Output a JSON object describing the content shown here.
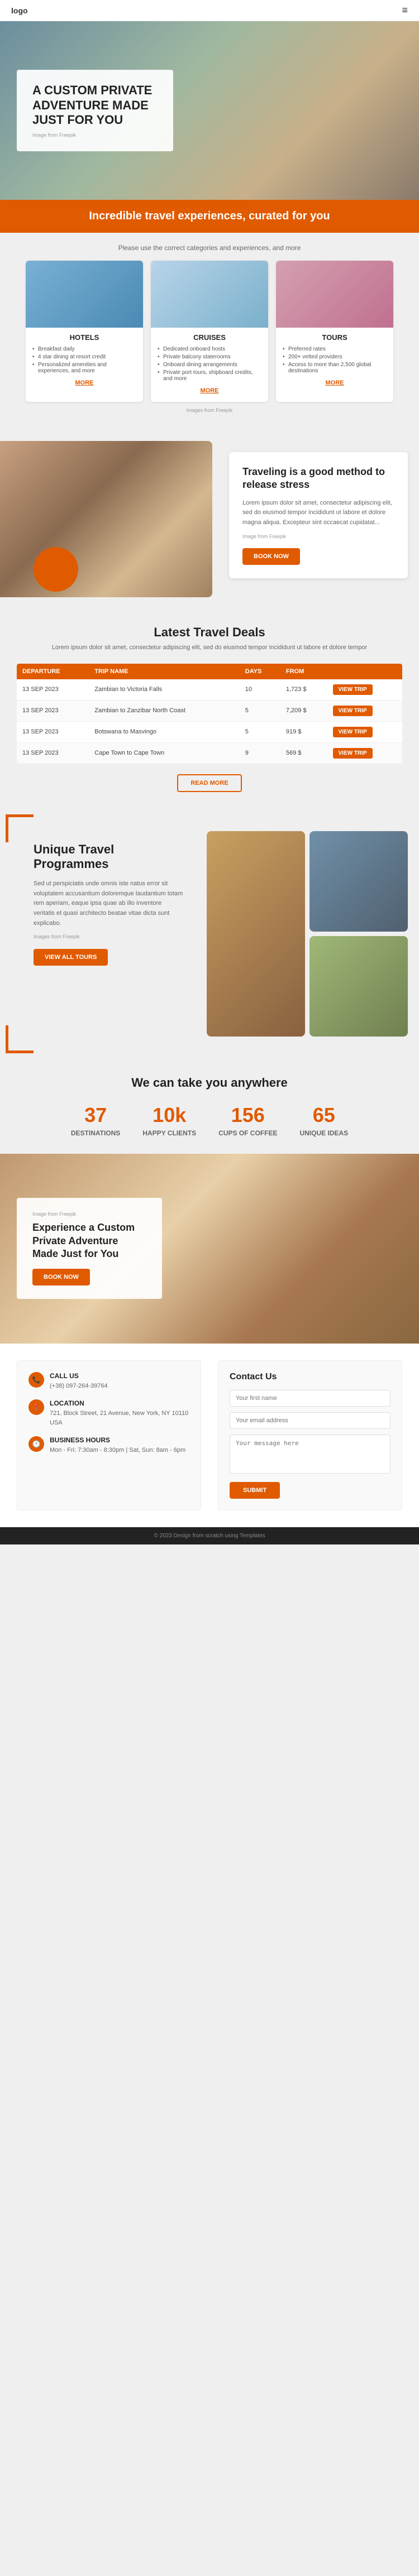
{
  "header": {
    "logo": "logo",
    "menu_icon": "≡"
  },
  "hero": {
    "title": "A CUSTOM PRIVATE ADVENTURE MADE JUST FOR YOU",
    "image_credit": "Image from Freepik"
  },
  "tagline": {
    "text": "Incredible travel experiences, curated for you"
  },
  "cards_section": {
    "subtitle": "Please use the correct categories and experiences, and more",
    "hotels": {
      "title": "HOTELS",
      "features": [
        "Breakfast daily",
        "4 star dining at resort credit",
        "Personalized amenities and experiences, and more"
      ],
      "more": "MORE"
    },
    "cruises": {
      "title": "CRUISES",
      "features": [
        "Dedicated onboard hosts",
        "Private balcony staterooms",
        "Onboard dining arrangements",
        "Private port tours, shipboard credits, and more"
      ],
      "more": "MORE"
    },
    "tours": {
      "title": "TOURS",
      "features": [
        "Preferred rates",
        "200+ vetted providers",
        "Access to more than 2,500 global destinations"
      ],
      "more": "MORE"
    },
    "image_credit": "Images from Freepik"
  },
  "stress": {
    "title": "Traveling is a good method to release stress",
    "body": "Lorem ipsum dolor sit amet, consectetur adipiscing elit, sed do eiusmod tempor incididunt ut labore et dolore magna aliqua. Excepteur sint occaecat cupidatat...",
    "image_credit": "Image from Freepik",
    "cta": "BOOK NOW"
  },
  "deals": {
    "title": "Latest Travel Deals",
    "subtitle": "Lorem ipsum dolor sit amet, consectetur adipiscing elit, sed do eiusmod tempor incididunt ut labore et dolore tempor",
    "columns": [
      "DEPARTURE",
      "TRIP NAME",
      "DAYS",
      "FROM",
      ""
    ],
    "rows": [
      {
        "departure": "13 SEP 2023",
        "trip": "Zambian to Victoria Falls",
        "days": "10",
        "from": "1,723 $",
        "btn": "VIEW TRIP"
      },
      {
        "departure": "13 SEP 2023",
        "trip": "Zambian to Zanzibar North Coast",
        "days": "5",
        "from": "7,209 $",
        "btn": "VIEW TRIP"
      },
      {
        "departure": "13 SEP 2023",
        "trip": "Botswana to Masvingo",
        "days": "5",
        "from": "919 $",
        "btn": "VIEW TRIP"
      },
      {
        "departure": "13 SEP 2023",
        "trip": "Cape Town to Cape Town",
        "days": "9",
        "from": "569 $",
        "btn": "VIEW TRIP"
      }
    ],
    "read_more": "READ MORE"
  },
  "programmes": {
    "title": "Unique Travel Programmes",
    "body": "Sed ut perspiciatis unde omnis iste natus error sit voluptatem accusantium doloremque laudantium totam rem aperiam, eaque ipsa quae ab illo inventore veritatis et quasi architecto beatae vitae dicta sunt explicabo.",
    "image_credit": "Images from Freepik",
    "cta": "VIEW ALL TOURS"
  },
  "stats": {
    "title": "We can take you anywhere",
    "items": [
      {
        "number": "37",
        "label": "DESTINATIONS"
      },
      {
        "number": "10k",
        "label": "HAPPY CLIENTS"
      },
      {
        "number": "156",
        "label": "CUPS OF COFFEE"
      },
      {
        "number": "65",
        "label": "UNIQUE IDEAS"
      }
    ]
  },
  "adventure": {
    "image_credit": "Image from Freepik",
    "title": "Experience a Custom Private Adventure Made Just for You",
    "cta": "BOOK NOW"
  },
  "footer": {
    "call_us": {
      "label": "CALL US",
      "value": "(+38) 097-264-39764"
    },
    "location": {
      "label": "LOCATION",
      "value": "721, Block Street, 21 Avenue, New York, NY 10110 USA"
    },
    "hours": {
      "label": "BUSINESS HOURS",
      "value": "Mon - Fri: 7:30am - 8:30pm | Sat, Sun: 8am - 6pm"
    },
    "contact": {
      "title": "Contact Us",
      "name_placeholder": "Your first name",
      "email_placeholder": "Your email address",
      "message_placeholder": "Your message here",
      "submit": "SUBMIT"
    }
  },
  "footer_bar": {
    "text": "© 2023 Design from scratch using Templates"
  }
}
